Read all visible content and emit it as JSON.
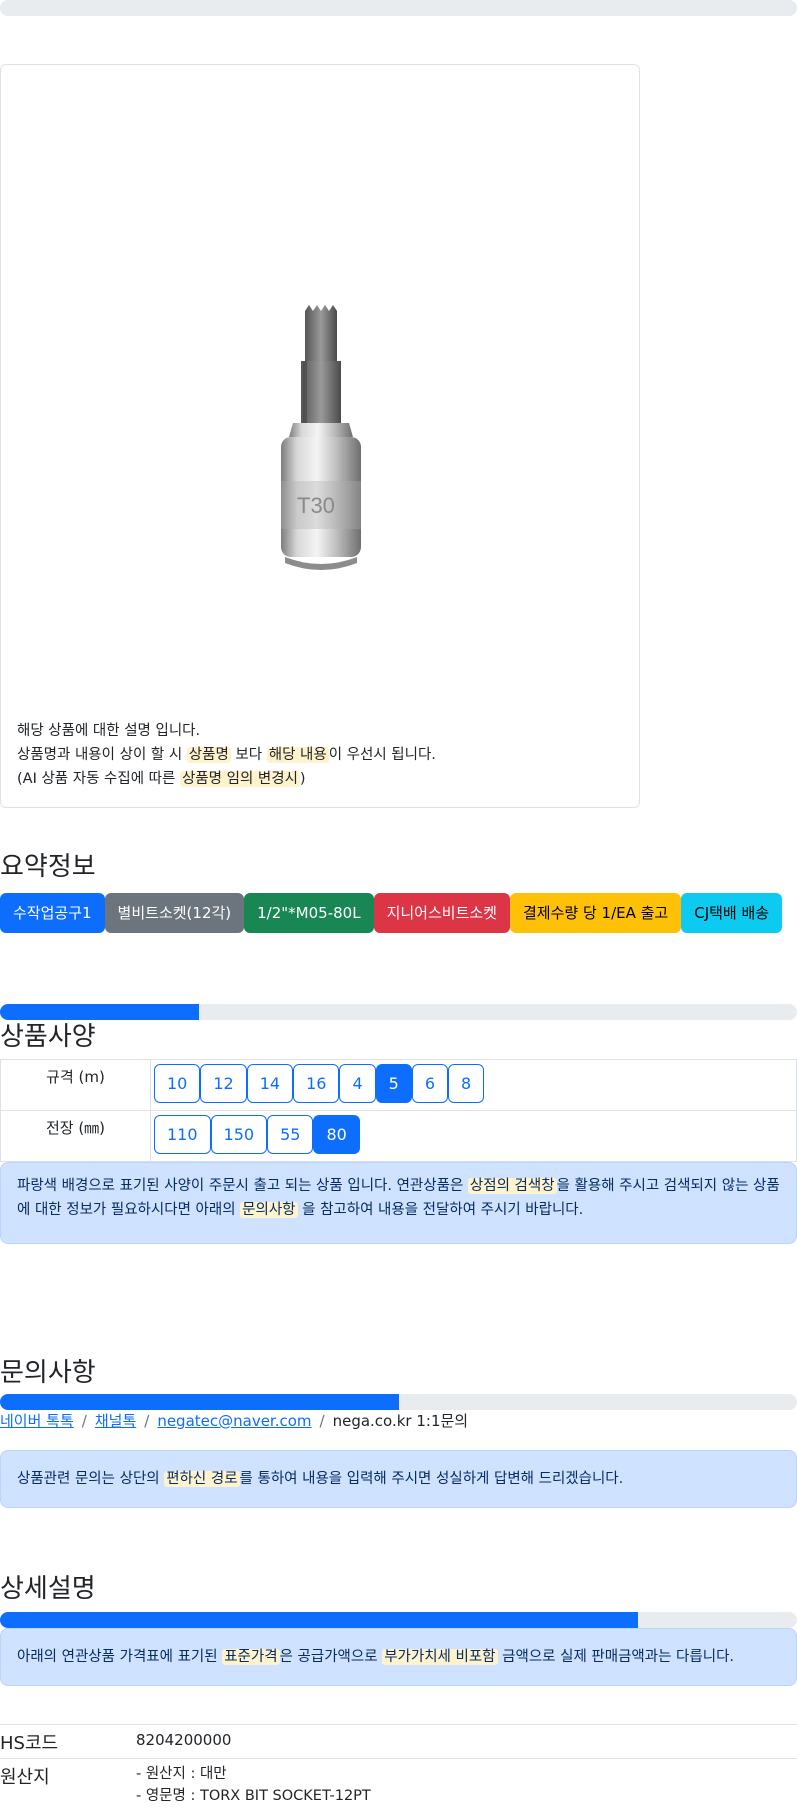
{
  "progress_top": 0,
  "description": {
    "line1": "해당 상품에 대한 설명 입니다.",
    "line2_a": "상품명과 내용이 상이 할 시 ",
    "line2_hl1": "상품명",
    "line2_b": " 보다 ",
    "line2_hl2": "해당 내용",
    "line2_c": "이 우선시 됩니다.",
    "line3_a": "(AI 상품 자동 수집에 따른 ",
    "line3_hl": "상품명 임의 변경시",
    "line3_b": ")"
  },
  "summary": {
    "title": "요약정보",
    "badges": [
      "수작업공구1",
      "별비트소켓(12각)",
      "1/2\"*M05-80L",
      "지니어스비트소켓",
      "결제수량 당 1/EA 출고",
      "CJ택배 배송"
    ]
  },
  "specs": {
    "title": "상품사양",
    "progress": 0.25,
    "rows": [
      {
        "label": "규격 (m)",
        "options": [
          "10",
          "12",
          "14",
          "16",
          "4",
          "5",
          "6",
          "8"
        ],
        "selected": "5"
      },
      {
        "label": "전장 (㎜)",
        "options": [
          "110",
          "150",
          "55",
          "80"
        ],
        "selected": "80"
      }
    ],
    "notice_a": "파랑색 배경으로 표기된 사양이 주문시 출고 되는 상품 입니다. 연관상품은 ",
    "notice_hl1": "상점의 검색창",
    "notice_b": "을 활용해 주시고 검색되지 않는 상품에 대한 정보가 필요하시다면 아래의 ",
    "notice_hl2": "문의사항",
    "notice_c": " 을 참고하여 내용을 전달하여 주시기 바랍니다."
  },
  "inquiry": {
    "title": "문의사항",
    "progress": 0.5,
    "links": [
      "네이버 톡톡",
      "채널톡",
      "negatec@naver.com"
    ],
    "plain": "nega.co.kr 1:1문의",
    "notice_a": "상품관련 문의는 상단의 ",
    "notice_hl": "편하신 경로",
    "notice_b": "를 통하여 내용을 입력해 주시면 성실하게 답변해 드리겠습니다."
  },
  "detail": {
    "title": "상세설명",
    "progress": 0.8,
    "notice_a": "아래의 연관상품 가격표에 표기된 ",
    "notice_hl1": "표준가격",
    "notice_b": "은 공급가액으로 ",
    "notice_hl2": "부가가치세 비포함",
    "notice_c": " 금액으로 실제 판매금액과는 다릅니다.",
    "hs_label": "HS코드",
    "hs_value": "8204200000",
    "origin_label": "원산지",
    "origin_line1": "- 원산지 : 대만",
    "origin_line2": "- 영문명 : TORX BIT SOCKET-12PT"
  },
  "colors": {
    "primary": "#0d6efd",
    "highlight": "#fff3cd",
    "alert_bg": "#cfe2ff"
  }
}
